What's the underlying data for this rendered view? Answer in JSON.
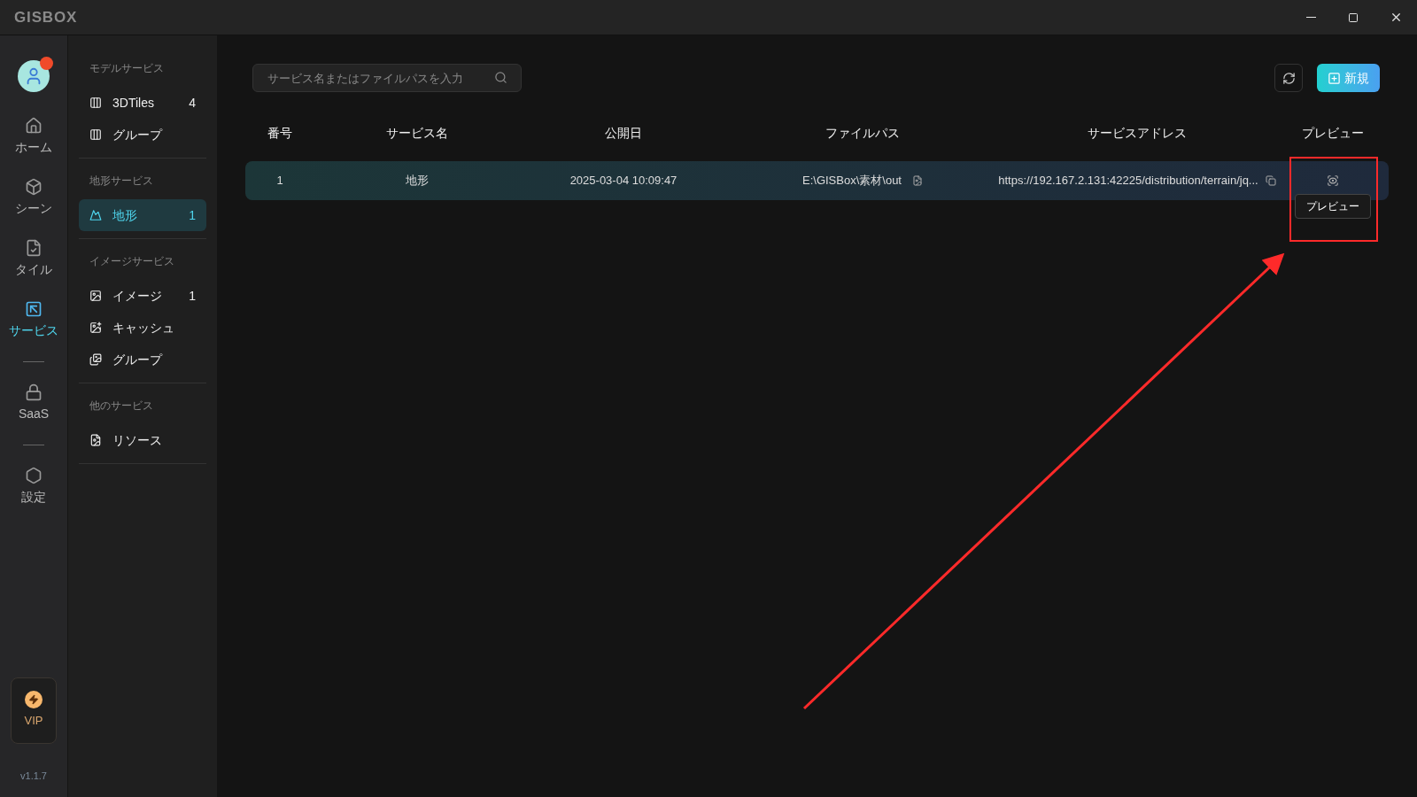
{
  "window": {
    "logo": "GISBOX"
  },
  "nav": [
    {
      "kind": "home",
      "label": "ホーム",
      "selected": false
    },
    {
      "kind": "scene",
      "label": "シーン",
      "selected": false
    },
    {
      "kind": "tile",
      "label": "タイル",
      "selected": false
    },
    {
      "kind": "service",
      "label": "サービス",
      "selected": true
    },
    {
      "kind": "saas",
      "label": "SaaS",
      "selected": false
    },
    {
      "kind": "settings",
      "label": "設定",
      "selected": false
    }
  ],
  "vip": {
    "label": "VIP"
  },
  "version": "v1.1.7",
  "sidebar": [
    {
      "title": "モデルサービス",
      "items": [
        {
          "kind": "model",
          "label": "3DTiles",
          "count": "4",
          "selected": false
        },
        {
          "kind": "model",
          "label": "グループ",
          "selected": false
        }
      ]
    },
    {
      "title": "地形サービス",
      "items": [
        {
          "kind": "terrain",
          "label": "地形",
          "count": "1",
          "selected": true
        }
      ]
    },
    {
      "title": "イメージサービス",
      "items": [
        {
          "kind": "image",
          "label": "イメージ",
          "count": "1",
          "selected": false
        },
        {
          "kind": "cache",
          "label": "キャッシュ",
          "selected": false
        },
        {
          "kind": "image-group",
          "label": "グループ",
          "selected": false
        }
      ]
    },
    {
      "title": "他のサービス",
      "items": [
        {
          "kind": "resource",
          "label": "リソース",
          "selected": false
        }
      ]
    }
  ],
  "search": {
    "placeholder": "サービス名またはファイルパスを入力"
  },
  "new_button": "新規",
  "table": {
    "columns": [
      "番号",
      "サービス名",
      "公開日",
      "ファイルパス",
      "サービスアドレス",
      "プレビュー"
    ],
    "rows": [
      {
        "number": "1",
        "name": "地形",
        "date": "2025-03-04 10:09:47",
        "path": "E:\\GISBox\\素材\\out",
        "address": "https://192.167.2.131:42225/distribution/terrain/jq..."
      }
    ]
  },
  "tooltip": "プレビュー"
}
